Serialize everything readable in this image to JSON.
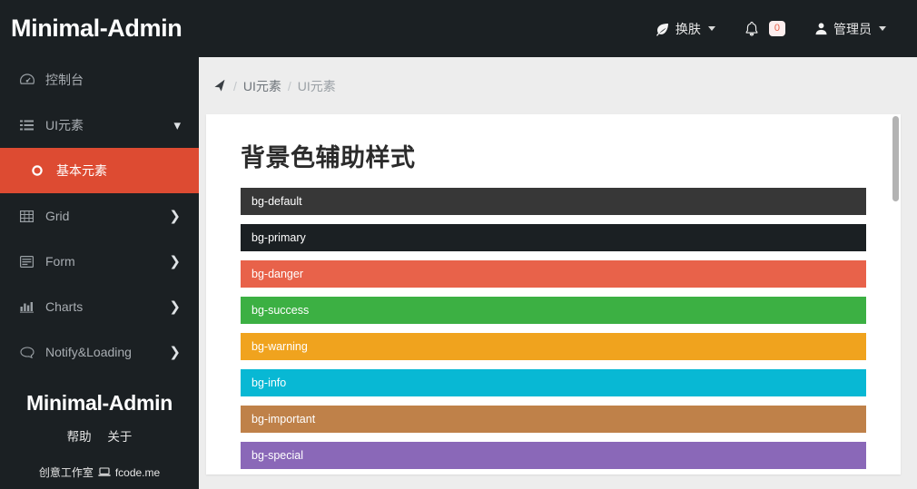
{
  "header": {
    "brand": "Minimal-Admin",
    "nav": [
      {
        "id": "theme",
        "icon": "leaf-icon",
        "label": "换肤",
        "caret": true
      },
      {
        "id": "notifications",
        "icon": "bell-icon",
        "label": "",
        "badge": "0",
        "caret": false
      },
      {
        "id": "user",
        "icon": "user-icon",
        "label": "管理员",
        "caret": true
      }
    ]
  },
  "sidebar": {
    "items": [
      {
        "id": "dashboard",
        "icon": "dashboard-icon",
        "label": "控制台",
        "chevron": "",
        "active": false
      },
      {
        "id": "ui-elements",
        "icon": "list-icon",
        "label": "UI元素",
        "chevron": "down",
        "active": false
      },
      {
        "id": "basic-elements",
        "icon": "circle-icon",
        "label": "基本元素",
        "chevron": "",
        "active": true
      },
      {
        "id": "grid",
        "icon": "grid-icon",
        "label": "Grid",
        "chevron": "right",
        "active": false
      },
      {
        "id": "form",
        "icon": "form-icon",
        "label": "Form",
        "chevron": "right",
        "active": false
      },
      {
        "id": "charts",
        "icon": "chart-icon",
        "label": "Charts",
        "chevron": "right",
        "active": false
      },
      {
        "id": "notify-loading",
        "icon": "comment-icon",
        "label": "Notify&Loading",
        "chevron": "right",
        "active": false
      }
    ],
    "footer": {
      "brand": "Minimal-Admin",
      "links": [
        "帮助",
        "关于"
      ],
      "studio": "创意工作室",
      "site": "fcode.me"
    }
  },
  "breadcrumb": {
    "icon": "location-arrow-icon",
    "items": [
      "UI元素",
      "UI元素"
    ],
    "separator": "/"
  },
  "main": {
    "title": "背景色辅助样式",
    "bars": [
      {
        "label": "bg-default",
        "color": "#373737"
      },
      {
        "label": "bg-primary",
        "color": "#1b2023"
      },
      {
        "label": "bg-danger",
        "color": "#e8624a"
      },
      {
        "label": "bg-success",
        "color": "#3cb043"
      },
      {
        "label": "bg-warning",
        "color": "#f0a31e"
      },
      {
        "label": "bg-info",
        "color": "#08b8d4"
      },
      {
        "label": "bg-important",
        "color": "#bf8149"
      },
      {
        "label": "bg-special",
        "color": "#8a68b8"
      }
    ]
  },
  "colors": {
    "header_bg": "#1b2023",
    "sidebar_bg": "#1b2023",
    "active_item": "#dd4b32",
    "page_bg": "#ededed",
    "card_bg": "#ffffff"
  }
}
